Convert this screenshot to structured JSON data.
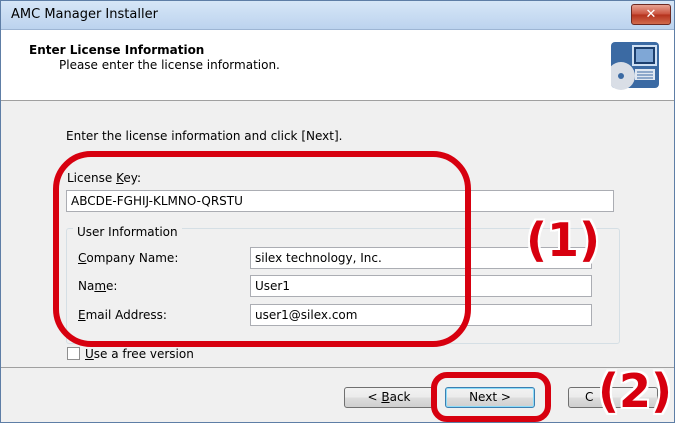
{
  "window": {
    "title": "AMC Manager Installer",
    "close_glyph": "✕"
  },
  "header": {
    "title": "Enter License Information",
    "subtitle": "Please enter the license information.",
    "logo_icon": "computer-disc-icon"
  },
  "body": {
    "instruction": "Enter the license information and click [Next].",
    "license_key": {
      "label_pre": "License ",
      "label_mnemonic": "K",
      "label_post": "ey:",
      "value": "ABCDE-FGHIJ-KLMNO-QRSTU"
    },
    "user_info": {
      "legend": "User Information",
      "company": {
        "label_pre": "",
        "label_mnemonic": "C",
        "label_post": "ompany Name:",
        "value": "silex technology, Inc."
      },
      "name": {
        "label_pre": "Na",
        "label_mnemonic": "m",
        "label_post": "e:",
        "value": "User1"
      },
      "email": {
        "label_pre": "",
        "label_mnemonic": "E",
        "label_post": "mail Address:",
        "value": "user1@silex.com"
      }
    },
    "free_version": {
      "label_mnemonic": "U",
      "label_post": "se a free version",
      "checked": false
    }
  },
  "footer": {
    "back_pre": "< ",
    "back_mnemonic": "B",
    "back_post": "ack",
    "next_label": "Next >",
    "cancel_partial": "C"
  },
  "annotations": {
    "label_1": "(1)",
    "label_2": "(2)",
    "color": "#d7000f"
  }
}
